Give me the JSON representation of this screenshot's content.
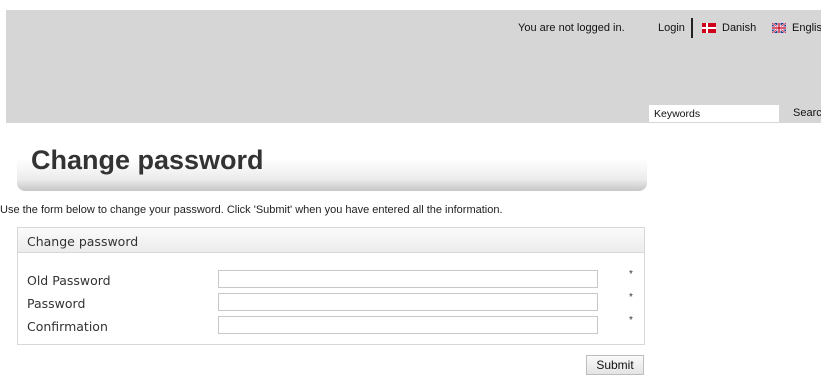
{
  "header": {
    "status_text": "You are not logged in.",
    "login_label": "Login",
    "languages": [
      {
        "label": "Danish",
        "flag": "danish-flag-icon"
      },
      {
        "label": "English",
        "flag": "uk-flag-icon"
      }
    ],
    "search": {
      "value": "Keywords",
      "button_label": "Search"
    }
  },
  "page": {
    "title": "Change password",
    "intro": "Use the form below to change your password. Click 'Submit' when you have entered all the information."
  },
  "form": {
    "legend": "Change password",
    "fields": [
      {
        "label": "Old Password",
        "value": "",
        "required_mark": "*"
      },
      {
        "label": "Password",
        "value": "",
        "required_mark": "*"
      },
      {
        "label": "Confirmation",
        "value": "",
        "required_mark": "*"
      }
    ],
    "submit_label": "Submit"
  },
  "colors": {
    "header_bg": "#d6d6d6",
    "fieldset_border": "#d8d8d8"
  }
}
